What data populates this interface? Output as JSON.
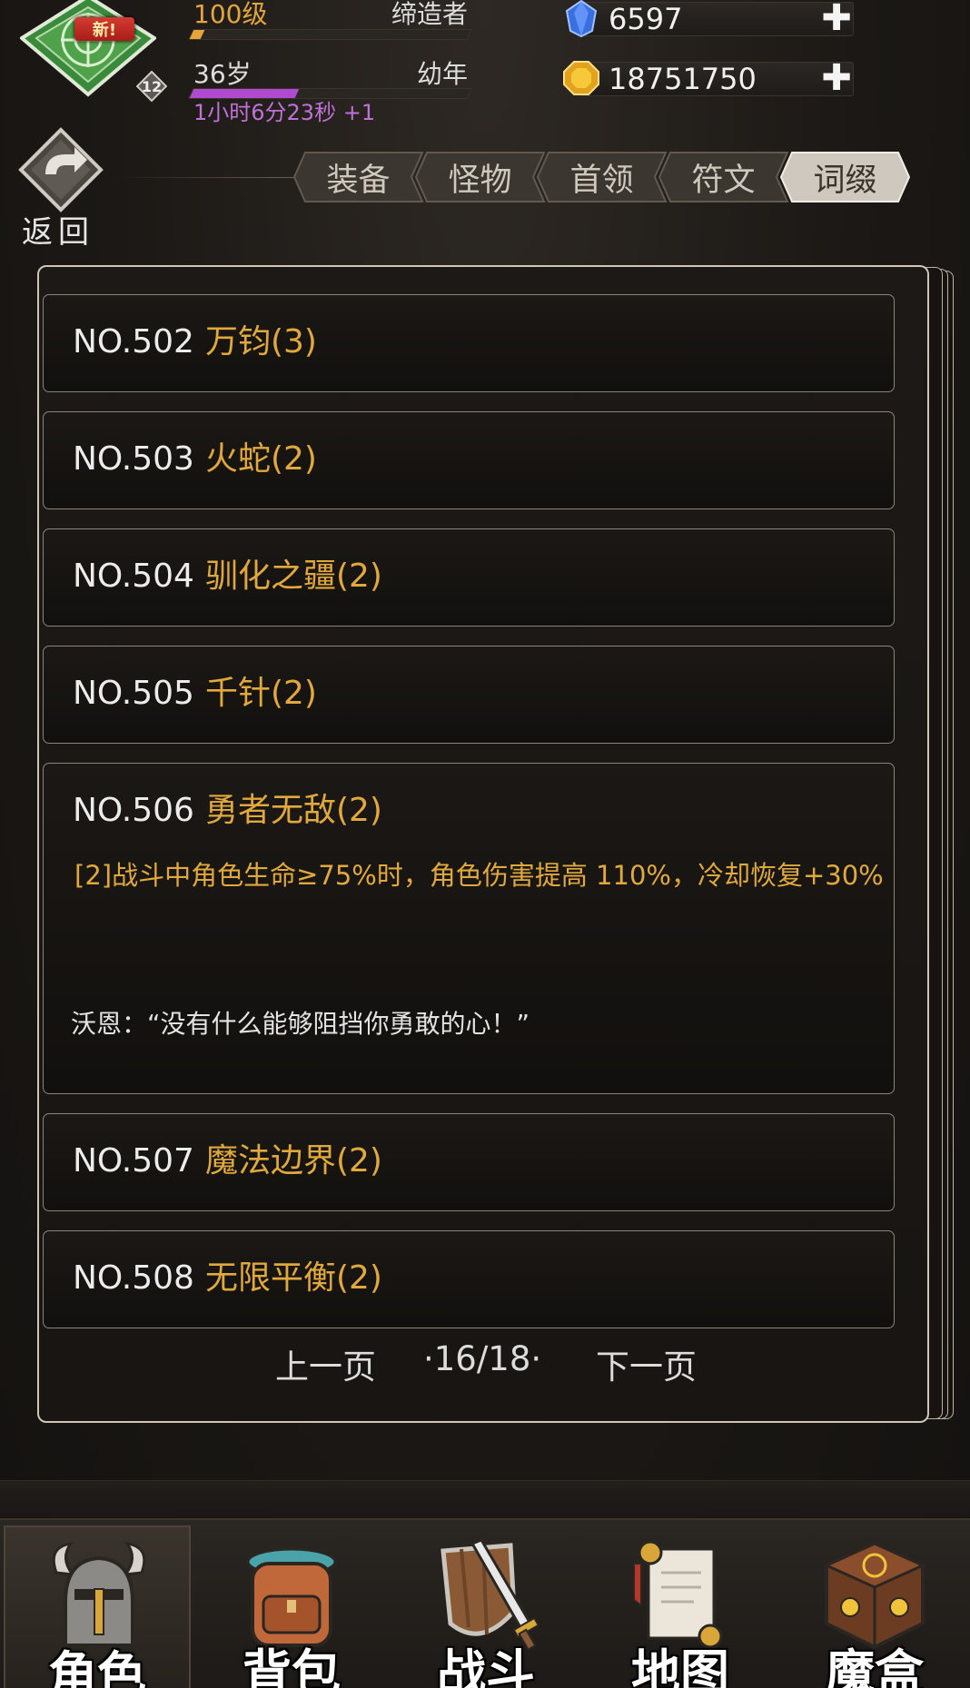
{
  "hud": {
    "new_badge": "新!",
    "avatar_level": "12",
    "level_text": "100级",
    "title_text": "缔造者",
    "level_progress": 0.04,
    "age_text": "36岁",
    "age_stage": "幼年",
    "age_progress": 0.38,
    "age_timer": "1小时6分23秒 +1",
    "colors": {
      "level_bar": "#e5a53a",
      "age_bar": "#b04ad0",
      "timer_text": "#c071d8"
    }
  },
  "currencies": [
    {
      "icon": "blue-diamond-icon",
      "value": "6597",
      "plus": "✚"
    },
    {
      "icon": "gold-gem-icon",
      "value": "18751750",
      "plus": "✚"
    }
  ],
  "back": {
    "label": "返回",
    "icon": "return-arrow-icon"
  },
  "tabs": [
    {
      "label": "装备",
      "active": false
    },
    {
      "label": "怪物",
      "active": false
    },
    {
      "label": "首领",
      "active": false
    },
    {
      "label": "符文",
      "active": false
    },
    {
      "label": "词缀",
      "active": true
    }
  ],
  "entries": [
    {
      "no": "NO.502",
      "name": "万钧(3)"
    },
    {
      "no": "NO.503",
      "name": "火蛇(2)"
    },
    {
      "no": "NO.504",
      "name": "驯化之疆(2)"
    },
    {
      "no": "NO.505",
      "name": "千针(2)"
    },
    {
      "no": "NO.506",
      "name": "勇者无敌(2)",
      "desc": "[2]战斗中角色生命≥75%时，角色伤害提高 110%，冷却恢复+30%",
      "quote": "沃恩：“没有什么能够阻挡你勇敢的心！”"
    },
    {
      "no": "NO.507",
      "name": "魔法边界(2)"
    },
    {
      "no": "NO.508",
      "name": "无限平衡(2)"
    }
  ],
  "pager": {
    "prev": "上一页",
    "pages": "·16/18·",
    "next": "下一页"
  },
  "nav": [
    {
      "label": "角色",
      "icon": "horned-helmet-icon",
      "active": true
    },
    {
      "label": "背包",
      "icon": "backpack-icon",
      "active": false
    },
    {
      "label": "战斗",
      "icon": "sword-shield-icon",
      "active": false
    },
    {
      "label": "地图",
      "icon": "scroll-map-icon",
      "active": false
    },
    {
      "label": "魔盒",
      "icon": "magic-box-icon",
      "active": false
    }
  ],
  "colors": {
    "gold_text": "#e1a93b",
    "panel_border": "#cfc6b8",
    "background": "#1a1714"
  }
}
